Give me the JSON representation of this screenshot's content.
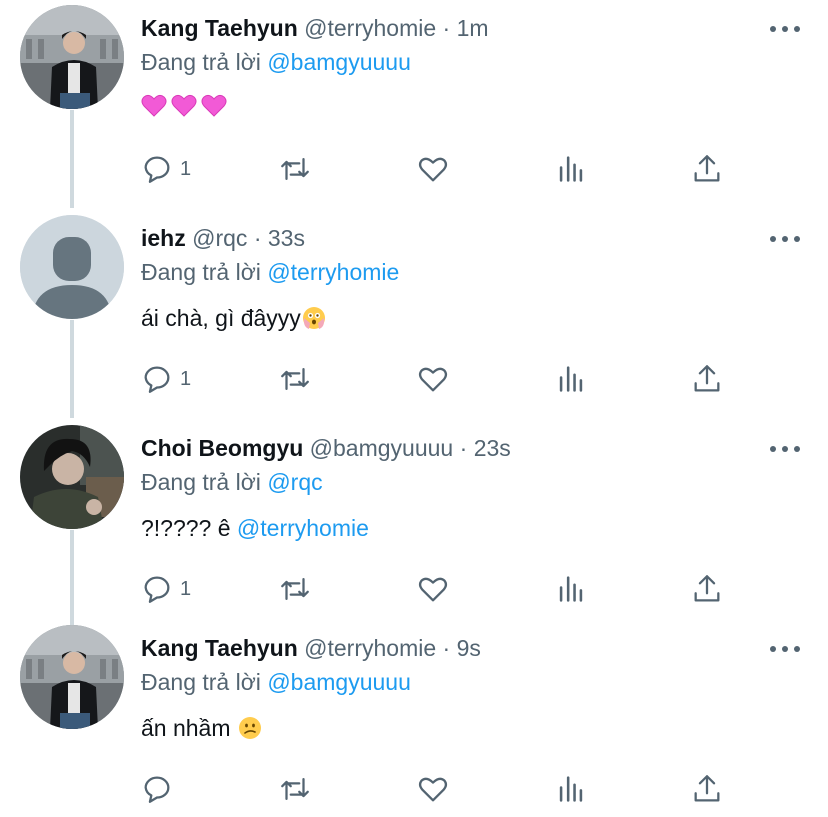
{
  "reply_prefix": "Đang trả lời",
  "colors": {
    "link": "#1d9bf0",
    "muted": "#536471",
    "text": "#0f1419",
    "thread_line": "#cfd9de"
  },
  "tweets": [
    {
      "name": "Kang Taehyun",
      "handle": "@terryhomie",
      "dot": "·",
      "time": "1m",
      "replying_to": "@bamgyuuuu",
      "avatar": "photo-louvre",
      "text_before": "",
      "mention": "",
      "emojis": [
        "pink-heart",
        "pink-heart",
        "pink-heart"
      ],
      "reply_count": "1"
    },
    {
      "name": "iehz",
      "handle": "@rqc",
      "dot": "·",
      "time": "33s",
      "replying_to": "@terryhomie",
      "avatar": "default-avatar",
      "text_before": "ái chà, gì đâyyy",
      "mention": "",
      "emojis": [
        "flushed-face-hands"
      ],
      "reply_count": "1"
    },
    {
      "name": "Choi Beomgyu",
      "handle": "@bamgyuuuu",
      "dot": "·",
      "time": "23s",
      "replying_to": "@rqc",
      "avatar": "photo-dark",
      "text_before": "?!???? ê ",
      "mention": "@terryhomie",
      "emojis": [],
      "reply_count": "1"
    },
    {
      "name": "Kang Taehyun",
      "handle": "@terryhomie",
      "dot": "·",
      "time": "9s",
      "replying_to": "@bamgyuuuu",
      "avatar": "photo-louvre",
      "text_before": "ấn nhầm ",
      "mention": "",
      "emojis": [
        "confused-face"
      ],
      "reply_count": ""
    }
  ]
}
